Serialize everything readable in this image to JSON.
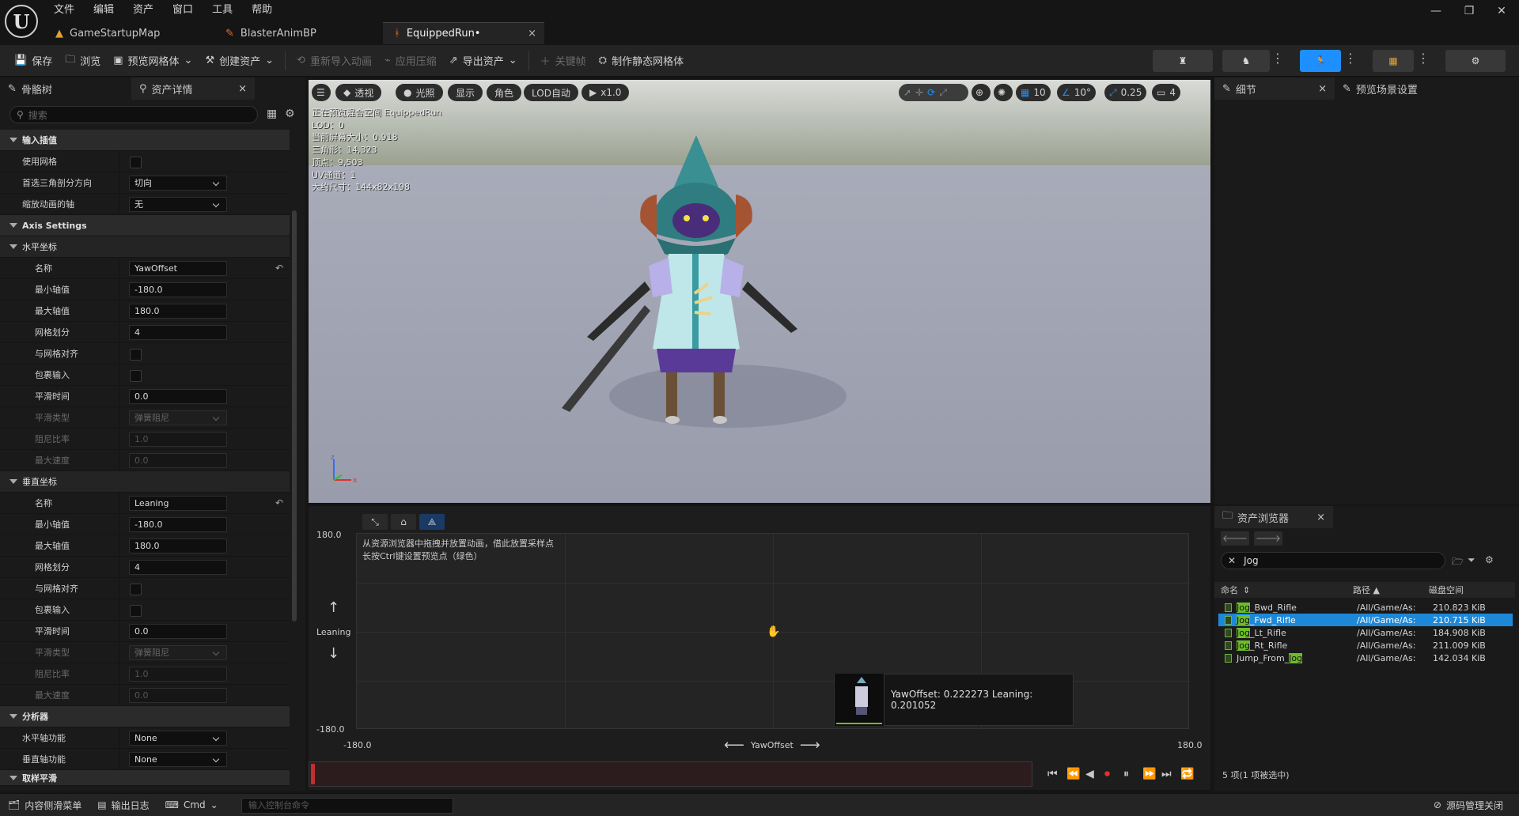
{
  "menu": [
    "文件",
    "编辑",
    "资产",
    "窗口",
    "工具",
    "帮助"
  ],
  "tabs": [
    {
      "label": "GameStartupMap",
      "icon": "level-icon"
    },
    {
      "label": "BlasterAnimBP",
      "icon": "anim-blueprint-icon"
    },
    {
      "label": "EquippedRun•",
      "icon": "blendspace-icon"
    }
  ],
  "toolbar": {
    "save": "保存",
    "browse": "浏览",
    "preview_mesh": "预览网格体",
    "create_asset": "创建资产",
    "reimport": "重新导入动画",
    "apply_compression": "应用压缩",
    "export_asset": "导出资产",
    "keyframe": "关键帧",
    "make_static_mesh": "制作静态网格体"
  },
  "left_panel": {
    "tab_skeleton": "骨骼树",
    "tab_asset_details": "资产详情",
    "search_placeholder": "搜索",
    "sections": {
      "input_interp": "输入插值",
      "axis_settings": "Axis Settings",
      "horizontal": "水平坐标",
      "vertical": "垂直坐标",
      "analysis": "分析器",
      "sample_smoothing": "取样平滑"
    },
    "labels": {
      "use_grid": "使用网格",
      "preferred_tri": "首选三角剖分方向",
      "scale_anim_axis": "缩放动画的轴",
      "name": "名称",
      "min": "最小轴值",
      "max": "最大轴值",
      "grid_div": "网格划分",
      "snap_grid": "与网格对齐",
      "wrap_input": "包裹输入",
      "smooth_time": "平滑时间",
      "smooth_type": "平滑类型",
      "damping": "阻尼比率",
      "max_speed": "最大速度",
      "h_axis_func": "水平轴功能",
      "v_axis_func": "垂直轴功能"
    },
    "values": {
      "preferred_tri": "切向",
      "scale_anim_axis": "无",
      "h_name": "YawOffset",
      "h_min": "-180.0",
      "h_max": "180.0",
      "h_grid": "4",
      "h_smooth_time": "0.0",
      "h_smooth_type": "弹簧阻尼",
      "h_damping": "1.0",
      "h_max_speed": "0.0",
      "v_name": "Leaning",
      "v_min": "-180.0",
      "v_max": "180.0",
      "v_grid": "4",
      "v_smooth_time": "0.0",
      "v_smooth_type": "弹簧阻尼",
      "v_damping": "1.0",
      "v_max_speed": "0.0",
      "h_func": "None",
      "v_func": "None"
    }
  },
  "viewport": {
    "perspective": "透视",
    "lit": "光照",
    "show": "显示",
    "character": "角色",
    "lod": "LOD自动",
    "speed": "x1.0",
    "grid_snap": "10",
    "rot_snap": "10°",
    "scale_snap": "0.25",
    "cam_speed": "4",
    "info": [
      "正在预览混合空间 EquippedRun",
      "LOD：0",
      "当前屏幕大小：0.918",
      "三角形：14,323",
      "顶点：9,503",
      "UV通道：1",
      "大约尺寸：144x82x198"
    ]
  },
  "blend_space": {
    "hint1": "从资源浏览器中拖拽并放置动画，借此放置采样点",
    "hint2": "长按Ctrl键设置预览点（绿色）",
    "y_max": "180.0",
    "y_min": "-180.0",
    "y_label": "Leaning",
    "x_min": "-180.0",
    "x_max": "180.0",
    "x_label": "YawOffset",
    "tooltip": "YawOffset: 0.222273  Leaning: 0.201052"
  },
  "details_panel": {
    "tab_details": "细节",
    "tab_preview_settings": "预览场景设置"
  },
  "content_browser": {
    "title": "资产浏览器",
    "search_value": "Jog",
    "col_name": "命名",
    "col_path": "路径",
    "col_size": "磁盘空间",
    "rows": [
      {
        "hl": "Jog",
        "rest": "_Bwd_Rifle",
        "pre": "",
        "path": "/All/Game/As:",
        "size": "210.823 KiB"
      },
      {
        "hl": "Jog",
        "rest": "_Fwd_Rifle",
        "pre": "",
        "path": "/All/Game/As:",
        "size": "210.715 KiB"
      },
      {
        "hl": "Jog",
        "rest": "_Lt_Rifle",
        "pre": "",
        "path": "/All/Game/As:",
        "size": "184.908 KiB"
      },
      {
        "hl": "Jog",
        "rest": "_Rt_Rifle",
        "pre": "",
        "path": "/All/Game/As:",
        "size": "211.009 KiB"
      },
      {
        "hl": "Jog",
        "rest": "",
        "pre": "Jump_From_",
        "path": "/All/Game/As:",
        "size": "142.034 KiB"
      }
    ],
    "footer": "5 项(1 项被选中)"
  },
  "statusbar": {
    "content_drawer": "内容侧滑菜单",
    "output_log": "输出日志",
    "cmd": "Cmd",
    "console_placeholder": "输入控制台命令",
    "source_control": "源码管理关闭"
  },
  "colors": {
    "accent_blue": "#1e88d8",
    "highlight_green": "#6dbd2a",
    "mode_active": "#1e8fff"
  }
}
